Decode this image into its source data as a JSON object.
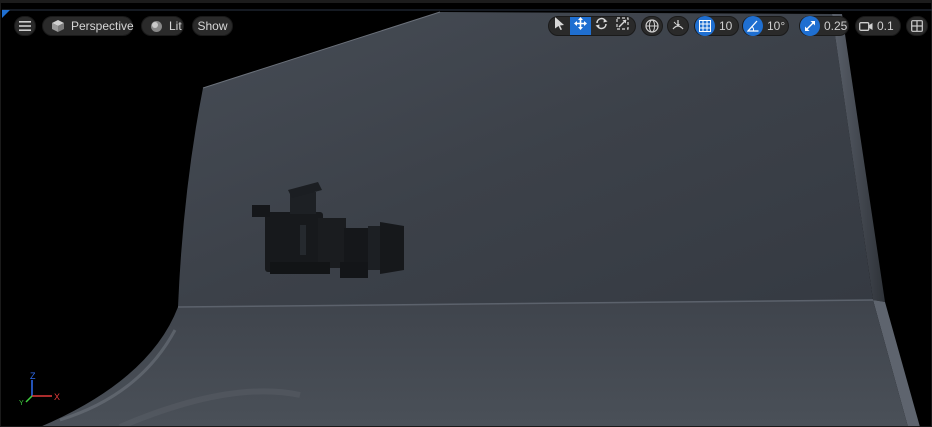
{
  "viewport": {
    "menu_icon": "hamburger-icon",
    "perspective_label": "Perspective",
    "lit_label": "Lit",
    "show_label": "Show"
  },
  "toolbar": {
    "transform_tools": [
      "select-arrow-icon",
      "translate-icon",
      "rotate-icon",
      "scale-icon"
    ],
    "active_tool": "translate-icon",
    "world_local_icon": "globe-icon",
    "surface_snap_icon": "surface-snap-icon",
    "grid_snap_value": "10",
    "rotation_snap_value": "10°",
    "scale_snap_value": "0.25",
    "camera_speed_value": "0.1",
    "layout_icon": "viewport-layout-icon"
  },
  "gizmo": {
    "x_label": "X",
    "y_label": "Y",
    "z_label": "Z"
  },
  "colors": {
    "accent": "#1f6fd1",
    "pill": "#2a2a2a",
    "backdrop": "#3e434b",
    "axis_x": "#e23b3b",
    "axis_y": "#3fcf3f",
    "axis_z": "#2f6df2"
  }
}
